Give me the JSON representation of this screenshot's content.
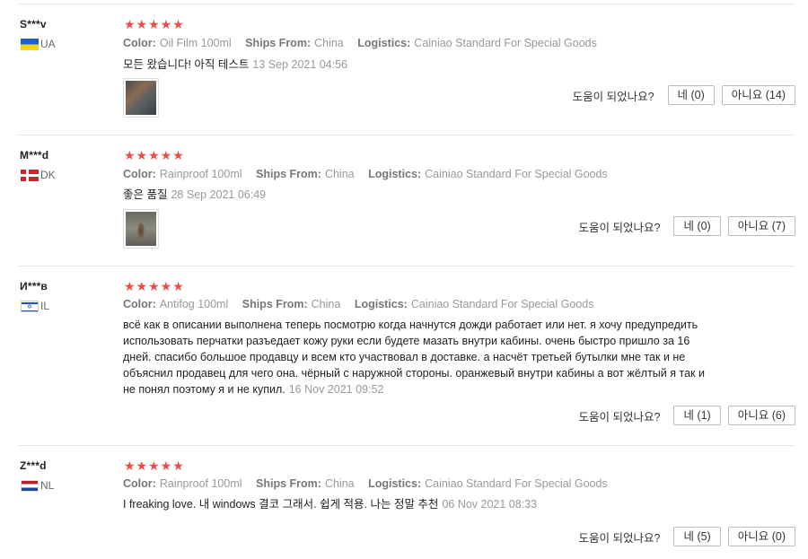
{
  "helpful_label": "도움이 되었나요?",
  "labels": {
    "color": "Color:",
    "ships_from": "Ships From:",
    "logistics": "Logistics:"
  },
  "reviews": [
    {
      "user": "S***v",
      "country": "UA",
      "rating": "★★★★★",
      "color": "Oil Film 100ml",
      "ships_from": "China",
      "logistics": "Cainiao Standard For Special Goods",
      "text": "모든 왔습니다! 아직 테스트",
      "date": "13 Sep 2021 04:56",
      "yes": "네 (0)",
      "no": "아니요 (14)"
    },
    {
      "user": "M***d",
      "country": "DK",
      "rating": "★★★★★",
      "color": "Rainproof 100ml",
      "ships_from": "China",
      "logistics": "Cainiao Standard For Special Goods",
      "text": "좋은 품질",
      "date": "28 Sep 2021 06:49",
      "yes": "네 (0)",
      "no": "아니요 (7)"
    },
    {
      "user": "И***в",
      "country": "IL",
      "rating": "★★★★★",
      "color": "Antifog 100ml",
      "ships_from": "China",
      "logistics": "Cainiao Standard For Special Goods",
      "text": "всё как в описании выполнена теперь посмотрю когда начнутся дожди работает или нет. я хочу предупредить использовать перчатки разъедает кожу руки если будете мазать внутри кабины. очень быстро пришло за 16 дней. спасибо большое продавцу и всем кто участвовал в доставке. а насчёт третьей бутылки мне так и не объяснил продавец для чего она. чёрный с наружной стороны. оранжевый внутри кабины а вот жёлтый я так и не понял поэтому я и не купил.",
      "date": "16 Nov 2021 09:52",
      "yes": "네 (1)",
      "no": "아니요 (6)"
    },
    {
      "user": "Z***d",
      "country": "NL",
      "rating": "★★★★★",
      "color": "Rainproof 100ml",
      "ships_from": "China",
      "logistics": "Cainiao Standard For Special Goods",
      "text": "I freaking love. 내 windows 결코 그래서. 쉽게 적용. 나는 정말 추천",
      "date": "06 Nov 2021 08:33",
      "yes": "네 (5)",
      "no": "아니요 (0)"
    }
  ]
}
